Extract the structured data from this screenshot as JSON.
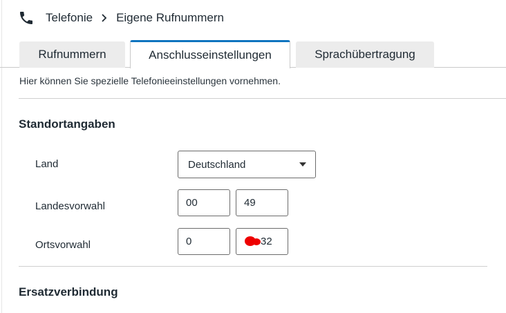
{
  "breadcrumb": {
    "parent": "Telefonie",
    "current": "Eigene Rufnummern"
  },
  "tabs": [
    {
      "label": "Rufnummern",
      "active": false
    },
    {
      "label": "Anschlusseinstellungen",
      "active": true
    },
    {
      "label": "Sprachübertragung",
      "active": false
    }
  ],
  "intro": "Hier können Sie spezielle Telefonieeinstellungen vornehmen.",
  "standort": {
    "title": "Standortangaben",
    "land_label": "Land",
    "land_value": "Deutschland",
    "landesvorwahl_label": "Landesvorwahl",
    "landesvorwahl_prefix": "00",
    "landesvorwahl_code": "49",
    "ortsvorwahl_label": "Ortsvorwahl",
    "ortsvorwahl_prefix": "0",
    "ortsvorwahl_code": "32"
  },
  "ersatz": {
    "title": "Ersatzverbindung"
  },
  "colors": {
    "accent": "#0e74bf",
    "redaction": "#ee0000"
  }
}
